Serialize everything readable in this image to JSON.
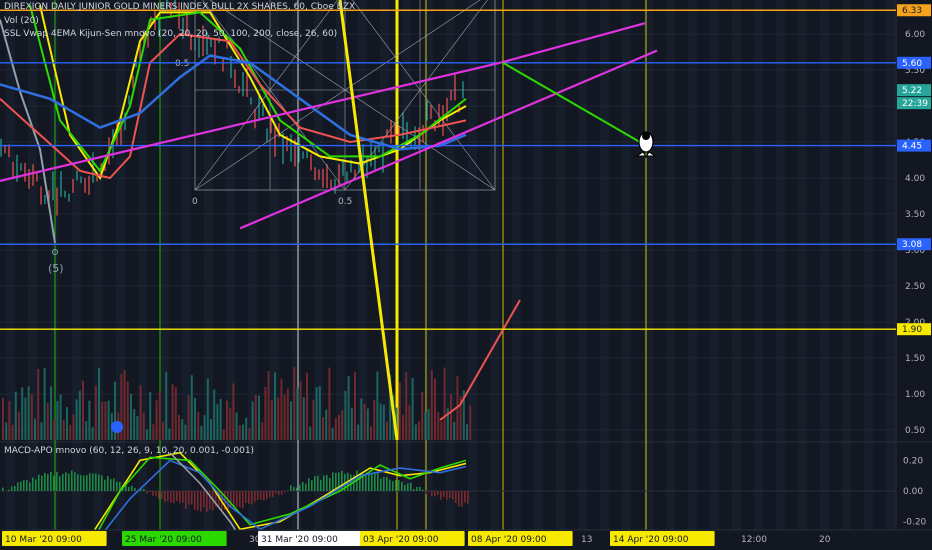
{
  "legends": {
    "main": "DIREXION DAILY JUNIOR GOLD MINERS INDEX BULL 2X SHARES, 60, Cboe BZX",
    "vol": "Vol (20)",
    "ssl": "SSL Vwap 4EMA Kijun-Sen mnovo (20, 20, 20, 50, 100, 200, close, 26, 60)",
    "macd": "MACD-APO mnovo (60, 12, 26, 9, 10, 20, 0.001, -0.001)"
  },
  "fib_labels": {
    "zero": "0",
    "half": "0.5",
    "half_top": "0.5"
  },
  "wave_label": "(5)",
  "colors": {
    "bg": "#131722",
    "up": "#26a69a",
    "down": "#ef5350",
    "yellow": "#f7ea00",
    "magenta": "#e032e0",
    "blue": "#2962ff",
    "orange": "#f7a21b",
    "green": "#2bd900"
  },
  "chart_data": {
    "type": "line",
    "price_axis": {
      "ticks": [
        "6.00",
        "5.50",
        "5.00",
        "4.50",
        "4.00",
        "3.50",
        "3.00",
        "2.50",
        "2.00",
        "1.50",
        "1.00",
        "0.50"
      ],
      "ylim": [
        0.4,
        6.4
      ]
    },
    "price_tags": [
      {
        "value": "6.33",
        "color": "#f7a21b",
        "text_color": "#131722"
      },
      {
        "value": "5.60",
        "color": "#2962ff",
        "text_color": "#ffffff"
      },
      {
        "value": "5.22",
        "color": "#26a69a",
        "text_color": "#ffffff"
      },
      {
        "value": "22:39",
        "color": "#26a69a",
        "text_color": "#ffffff"
      },
      {
        "value": "4.45",
        "color": "#2962ff",
        "text_color": "#ffffff"
      },
      {
        "value": "3.08",
        "color": "#2962ff",
        "text_color": "#ffffff"
      },
      {
        "value": "1.90",
        "color": "#f7ea00",
        "text_color": "#131722"
      }
    ],
    "horizontal_levels": [
      {
        "value": 6.33,
        "color": "#f7a21b"
      },
      {
        "value": 5.6,
        "color": "#2962ff"
      },
      {
        "value": 4.45,
        "color": "#2962ff"
      },
      {
        "value": 3.08,
        "color": "#2962ff"
      },
      {
        "value": 1.9,
        "color": "#f7ea00"
      }
    ],
    "macd_axis": {
      "ticks": [
        "0.20",
        "0.00",
        "-0.20"
      ],
      "ylim": [
        -0.25,
        0.25
      ]
    },
    "time_labels": [
      {
        "text": "10 Mar '20  09:00",
        "highlight": "#f7ea00"
      },
      {
        "text": "25 Mar '20  09:00",
        "highlight": "#2bd900"
      },
      {
        "text": "30",
        "highlight": ""
      },
      {
        "text": "31 Mar '20  09:00",
        "highlight": "#ffffff"
      },
      {
        "text": "03 Apr '20  09:00",
        "highlight": "#f7ea00"
      },
      {
        "text": "08 Apr '20  09:00",
        "highlight": "#f7ea00"
      },
      {
        "text": "13",
        "highlight": ""
      },
      {
        "text": "14 Apr '20  09:00",
        "highlight": "#f7ea00"
      },
      {
        "text": "12:00",
        "highlight": ""
      },
      {
        "text": "20",
        "highlight": ""
      }
    ],
    "projection_target": 4.45,
    "last_price": 5.22
  }
}
